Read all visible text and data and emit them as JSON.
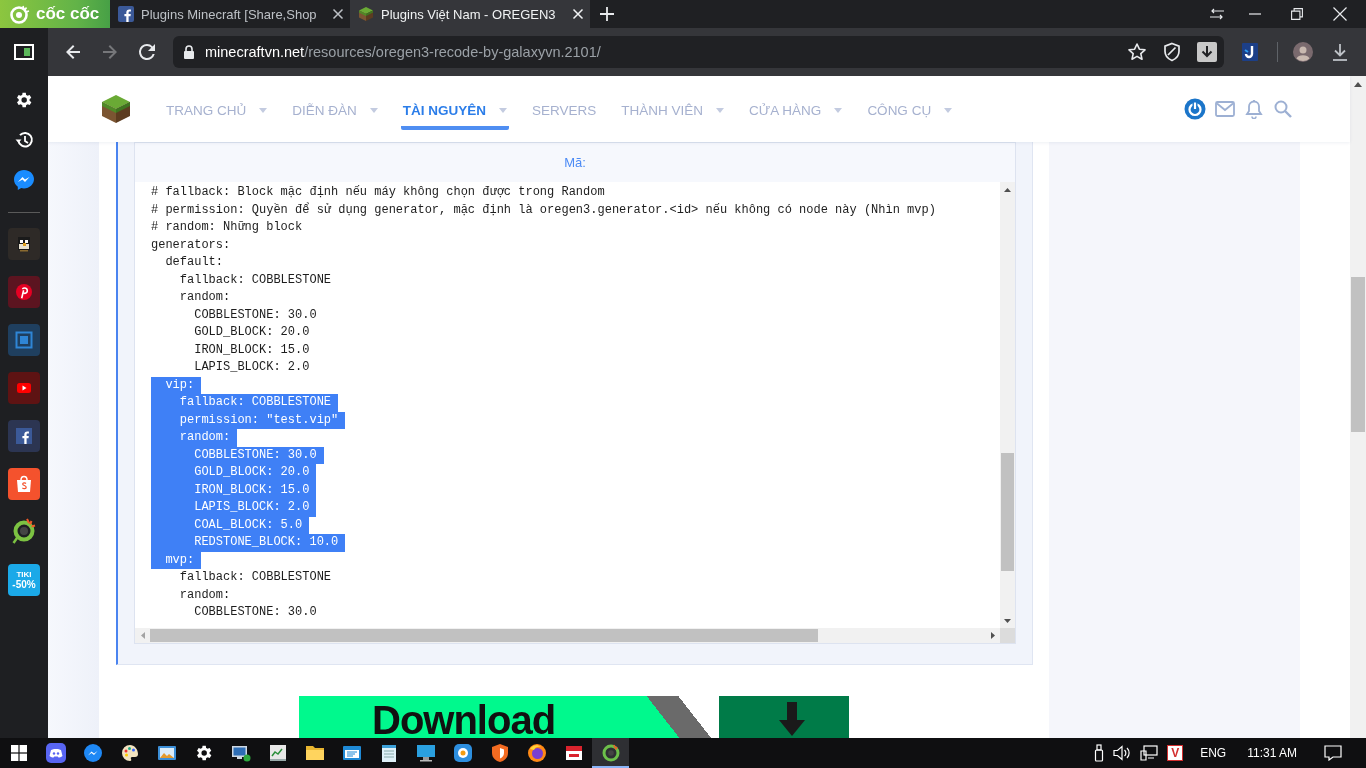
{
  "browser": {
    "logo": "cốc cốc",
    "tabs": [
      {
        "kind": "facebook",
        "title": "Plugins Minecraft [Share,Shop",
        "selected": false
      },
      {
        "kind": "grass-block",
        "title": "Plugins Việt Nam - OREGEN3",
        "selected": true
      }
    ],
    "nav_buttons": [
      {
        "kind": "back",
        "disabled": false
      },
      {
        "kind": "forward",
        "disabled": true
      },
      {
        "kind": "reload",
        "disabled": false
      }
    ],
    "address_bar": {
      "domain": "minecraftvn.net",
      "path": "/resources/oregen3-recode-by-galaxyvn.2101/"
    }
  },
  "side_panel": {
    "promo_tile": {
      "brand": "TIKI",
      "badge": "-50%"
    }
  },
  "site_header": {
    "nav": [
      {
        "label": "TRANG CHỦ",
        "selected": false,
        "dropdown": true
      },
      {
        "label": "DIỄN ĐÀN",
        "selected": false,
        "dropdown": true
      },
      {
        "label": "TÀI NGUYÊN",
        "selected": true,
        "dropdown": true
      },
      {
        "label": "SERVERS",
        "selected": false,
        "dropdown": false
      },
      {
        "label": "THÀNH VIÊN",
        "selected": false,
        "dropdown": true
      },
      {
        "label": "CỬA HÀNG",
        "selected": false,
        "dropdown": true
      },
      {
        "label": "CÔNG CỤ",
        "selected": false,
        "dropdown": true
      }
    ]
  },
  "code_block": {
    "title": "Mã:",
    "lines": [
      {
        "text": "# fallback: Block mặc định nếu máy không chọn được trong Random",
        "selected": false
      },
      {
        "text": "# permission: Quyền để sử dụng generator, mặc định là oregen3.generator.<id> nếu không có node này (Nhìn mvp)",
        "selected": false
      },
      {
        "text": "# random: Những block",
        "selected": false
      },
      {
        "text": "generators:",
        "selected": false
      },
      {
        "text": "  default:",
        "selected": false
      },
      {
        "text": "    fallback: COBBLESTONE",
        "selected": false
      },
      {
        "text": "    random:",
        "selected": false
      },
      {
        "text": "      COBBLESTONE: 30.0",
        "selected": false
      },
      {
        "text": "      GOLD_BLOCK: 20.0",
        "selected": false
      },
      {
        "text": "      IRON_BLOCK: 15.0",
        "selected": false
      },
      {
        "text": "      LAPIS_BLOCK: 2.0",
        "selected": false
      },
      {
        "text": "  vip:",
        "selected": true
      },
      {
        "text": "    fallback: COBBLESTONE",
        "selected": true
      },
      {
        "text": "    permission: \"test.vip\"",
        "selected": true
      },
      {
        "text": "    random:",
        "selected": true
      },
      {
        "text": "      COBBLESTONE: 30.0",
        "selected": true
      },
      {
        "text": "      GOLD_BLOCK: 20.0",
        "selected": true
      },
      {
        "text": "      IRON_BLOCK: 15.0",
        "selected": true
      },
      {
        "text": "      LAPIS_BLOCK: 2.0",
        "selected": true
      },
      {
        "text": "      COAL_BLOCK: 5.0",
        "selected": true
      },
      {
        "text": "      REDSTONE_BLOCK: 10.0",
        "selected": true
      },
      {
        "text": "  mvp:",
        "selected": true
      },
      {
        "text": "    fallback: COBBLESTONE",
        "selected": false
      },
      {
        "text": "    random:",
        "selected": false
      },
      {
        "text": "      COBBLESTONE: 30.0",
        "selected": false
      }
    ]
  },
  "download_banner": {
    "text": "Download"
  },
  "taskbar": {
    "apps": [
      {
        "kind": "start",
        "active": false
      },
      {
        "kind": "controller",
        "active": false
      },
      {
        "kind": "chat",
        "active": false
      },
      {
        "kind": "palette",
        "active": false
      },
      {
        "kind": "picture",
        "active": false
      },
      {
        "kind": "settings",
        "active": false
      },
      {
        "kind": "remote-screen",
        "active": false
      },
      {
        "kind": "chart-window",
        "active": false
      },
      {
        "kind": "folder",
        "active": false
      },
      {
        "kind": "window",
        "active": false
      },
      {
        "kind": "notepad",
        "active": false
      },
      {
        "kind": "monitor",
        "active": false
      },
      {
        "kind": "round-app",
        "active": false
      },
      {
        "kind": "shield",
        "active": false
      },
      {
        "kind": "globe",
        "active": false
      },
      {
        "kind": "document",
        "active": false
      },
      {
        "kind": "ring",
        "active": true
      }
    ],
    "input_mode": "V",
    "language": "ENG",
    "time": "11:31 AM"
  }
}
